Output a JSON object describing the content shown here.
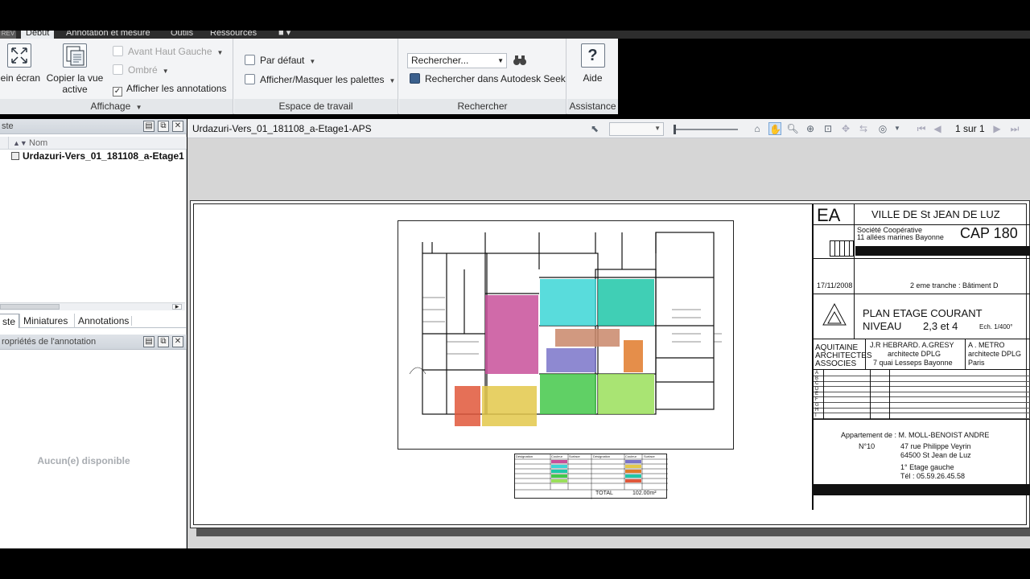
{
  "tabs": {
    "app_btn": "REV",
    "debut": "Début",
    "annotation": "Annotation et mesure",
    "outils": "Outils",
    "ressources": "Ressources"
  },
  "ribbon": {
    "affichage": {
      "title": "Affichage",
      "plein_ecran": "lein écran",
      "copier_line1": "Copier la vue",
      "copier_line2": "active",
      "avant_haut_gauche": "Avant Haut Gauche",
      "ombre": "Ombré",
      "afficher_annotations": "Afficher les annotations"
    },
    "espace": {
      "title": "Espace de travail",
      "par_defaut": "Par défaut",
      "afficher_masquer": "Afficher/Masquer les palettes"
    },
    "rechercher": {
      "title": "Rechercher",
      "combo_value": "Rechercher...",
      "seek": "Rechercher dans Autodesk Seek"
    },
    "assistance": {
      "title": "Assistance",
      "aide": "Aide"
    }
  },
  "left_panel": {
    "header1": "ste",
    "col_nom": "Nom",
    "tree_item": "Urdazuri-Vers_01_181108_a-Etage1",
    "tab_liste": "ste",
    "tab_miniatures": "Miniatures",
    "tab_annotations": "Annotations",
    "header2": "ropriétés de l'annotation",
    "empty": "Aucun(e) disponible"
  },
  "viewer": {
    "title": "Urdazuri-Vers_01_181108_a-Etage1-APS",
    "page": "1 sur 1"
  },
  "titleblock": {
    "ea": "EA",
    "ville": "VILLE DE St JEAN DE LUZ",
    "societe": "Société Coopérative",
    "adresse_soc": "11 allées marines Bayonne",
    "cap": "CAP 180",
    "date": "17/11/2008",
    "tranche": "2 eme tranche : Bâtiment D",
    "plan": "PLAN ETAGE COURANT",
    "niveau": "NIVEAU",
    "niveau_val": "2,3 et  4",
    "echelle": "Ech. 1/400°",
    "aquitaine1": "AQUITAINE",
    "aquitaine2": "ARCHITECTES",
    "aquitaine3": "ASSOCIES",
    "hebrard1": "J.R HEBRARD. A.GRESY",
    "hebrard2": "architecte DPLG",
    "hebrard3": "7 quai Lesseps Bayonne",
    "metro1": "A . METRO",
    "metro2": "architecte DPLG",
    "metro3": "Paris",
    "rev_letters": [
      "A",
      "B",
      "C",
      "D",
      "E",
      "F",
      "G",
      "H",
      "I"
    ],
    "appartement": "Appartement de : M. MOLL-BENOIST ANDRE",
    "numero": "N°10",
    "addr1": "47 rue Philippe Veyrin",
    "addr2": "64500 St Jean de Luz",
    "etage": "1° Etage gauche",
    "tel": "Tél : 05.59.26.45.58"
  },
  "legend": {
    "headers": [
      "Désignation",
      "Couleur",
      "Surface",
      "Désignation",
      "Couleur",
      "Surface"
    ],
    "total_label": "TOTAL",
    "total_value": "102.00m²"
  },
  "colors": {
    "sejour": "#c8509a",
    "ch1": "#3cd6d6",
    "ch2": "#1fc7a8",
    "ch3": "#44c84a",
    "ch4": "#9adf5a",
    "cuisine": "#e3c84a",
    "degagement": "#c9876a",
    "bains": "#7a74c9",
    "cellier": "#e0573a",
    "wc": "#e07a2a"
  }
}
